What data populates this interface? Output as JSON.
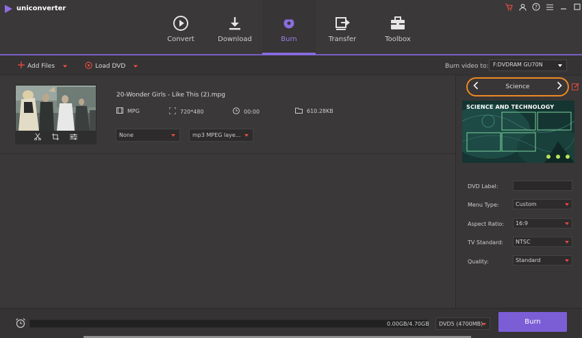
{
  "app": {
    "name": "uniconverter"
  },
  "nav": [
    {
      "id": "convert",
      "label": "Convert",
      "icon": "convert-icon",
      "active": false
    },
    {
      "id": "download",
      "label": "Download",
      "icon": "download-icon",
      "active": false
    },
    {
      "id": "burn",
      "label": "Burn",
      "icon": "burn-icon",
      "active": true
    },
    {
      "id": "transfer",
      "label": "Transfer",
      "icon": "transfer-icon",
      "active": false
    },
    {
      "id": "toolbox",
      "label": "Toolbox",
      "icon": "toolbox-icon",
      "active": false
    }
  ],
  "toolbar": {
    "add_files": "Add Files",
    "load_dvd": "Load DVD",
    "burn_video_to_label": "Burn video to:",
    "burn_target": "F:DVDRAM GU70N"
  },
  "file": {
    "name": "20-Wonder Girls - Like This (2).mpg",
    "format": "MPG",
    "resolution": "720*480",
    "duration": "00:00",
    "size": "610.28KB",
    "subtitle_option": "None",
    "audio_option": "mp3 MPEG laye..."
  },
  "theme": {
    "name": "Science",
    "preview_title": "SCIENCE AND TECHNOLOGY"
  },
  "settings": {
    "dvd_label": {
      "label": "DVD Label:",
      "value": ""
    },
    "menu_type": {
      "label": "Menu Type:",
      "value": "Custom"
    },
    "aspect_ratio": {
      "label": "Aspect Ratio:",
      "value": "16:9"
    },
    "tv_standard": {
      "label": "TV Standard:",
      "value": "NTSC"
    },
    "quality": {
      "label": "Quality:",
      "value": "Standard"
    }
  },
  "bottom": {
    "usage": "0.00GB/4.70GB",
    "disc_type": "DVD5 (4700MB)",
    "burn_button": "Burn"
  },
  "colors": {
    "accent": "#7b5ed6",
    "highlight_ring": "#f08a24",
    "dropdown_arrow": "#e14b41"
  }
}
